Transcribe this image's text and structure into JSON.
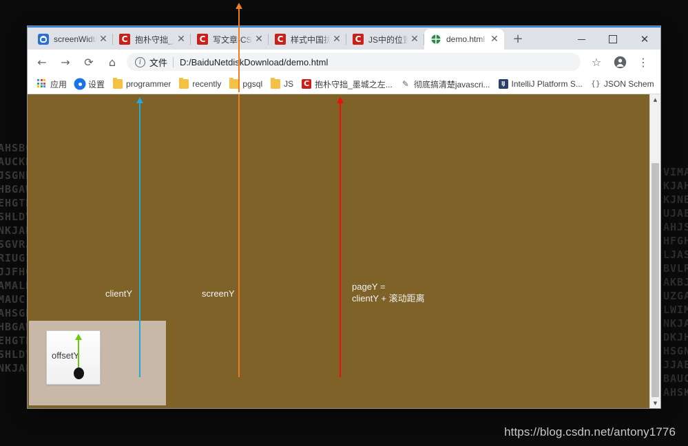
{
  "desktop": {
    "watermark": "https://blog.csdn.net/antony1776",
    "matrix_left": "AHSBG\nAUCKN\nJSGND\nHBGAW\nEHGTR\nSHLDV\nNKJAH\nSGVRJN\nRIUGIL\nJJFHGN\nAMALK\nMAUC\nAHSGN\nHBGAW\nEHGTR\nSHLDV\nNKJAH",
    "matrix_right": "VIMAU\nKJAHS\nKJNBG\nUJAEH\nAHJSH\nHFGHK\nLJASGV\nBVLRI\nAKBJF\nUZGAM\nLWIM\nNKJAH\nDKJH\nHSGN\nJJAEH\nBAUC\nAHSK"
  },
  "browser": {
    "window_controls": {
      "minimize": "minimize-label",
      "maximize": "maximize-label",
      "close": "close-label"
    },
    "tabs": [
      {
        "title": "screenWidth,cli",
        "favicon": "baidu-icon",
        "active": false
      },
      {
        "title": "抱朴守拙_墨城之",
        "favicon": "csdn-icon",
        "favicon_text": "C",
        "active": false
      },
      {
        "title": "写文章-CSDN博",
        "favicon": "csdn-icon",
        "favicon_text": "C",
        "active": false
      },
      {
        "title": "样式中国扰我们",
        "favicon": "csdn-icon",
        "favicon_text": "C",
        "active": false
      },
      {
        "title": "JS中的位置和宽",
        "favicon": "csdn-icon",
        "favicon_text": "C",
        "active": false
      },
      {
        "title": "demo.html",
        "favicon": "globe-icon",
        "active": true
      }
    ],
    "tab_close_glyph": "✕",
    "new_tab_glyph": "+",
    "toolbar": {
      "back_glyph": "←",
      "forward_glyph": "→",
      "reload_glyph": "⟳",
      "home_glyph": "⌂",
      "omnibox": {
        "info_glyph": "i",
        "scheme_label": "文件",
        "url": "D:/BaiduNetdiskDownload/demo.html"
      },
      "bookmark_star_glyph": "☆",
      "profile_glyph": "●",
      "menu_glyph": "⋮"
    },
    "bookmarks": [
      {
        "label": "应用",
        "icon": "apps-grid-icon"
      },
      {
        "label": "设置",
        "icon": "gear-icon"
      },
      {
        "label": "programmer",
        "icon": "folder-icon"
      },
      {
        "label": "recently",
        "icon": "folder-icon"
      },
      {
        "label": "pgsql",
        "icon": "folder-icon"
      },
      {
        "label": "JS",
        "icon": "folder-icon"
      },
      {
        "label": "抱朴守拙_墨城之左...",
        "icon": "csdn-icon",
        "icon_text": "C"
      },
      {
        "label": "彻底搞清楚javascri...",
        "icon": "pen-icon",
        "icon_text": "✎"
      },
      {
        "label": "IntelliJ Platform S...",
        "icon": "intellij-icon",
        "icon_text": "IJ"
      },
      {
        "label": "JSON Schem",
        "icon": "json-icon",
        "icon_text": "{}"
      }
    ],
    "bookmarks_overflow_glyph": "»"
  },
  "page": {
    "background_color": "#7e6228",
    "page_box_color": "#c8b8a8",
    "scrollbar": {
      "up_arrow_glyph": "▲",
      "down_arrow_glyph": "▼"
    },
    "annotations": [
      {
        "name": "clientY",
        "label": "clientY",
        "color": "#29a8d8"
      },
      {
        "name": "screenY",
        "label": "screenY",
        "color": "#ef7b23"
      },
      {
        "name": "pageY",
        "label": "pageY =\nclientY + 滚动距离",
        "color": "#f20d0d"
      },
      {
        "name": "offsetY",
        "label": "offsetY",
        "color": "#6ec60e"
      }
    ]
  }
}
